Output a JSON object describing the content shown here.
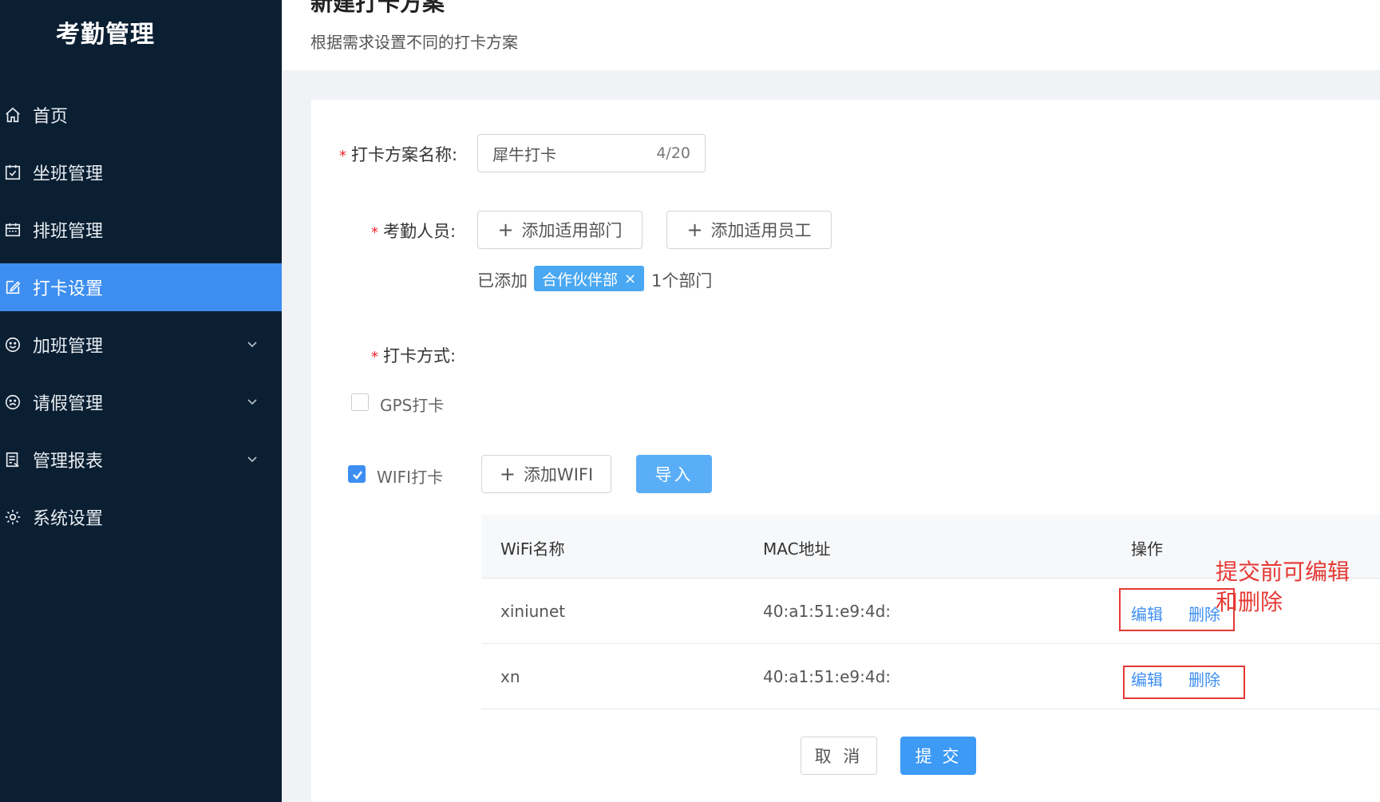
{
  "sidebar": {
    "brand": "考勤管理",
    "items": [
      {
        "label": "首页",
        "icon": "home-icon"
      },
      {
        "label": "坐班管理",
        "icon": "calendar-check-icon"
      },
      {
        "label": "排班管理",
        "icon": "calendar-icon"
      },
      {
        "label": "打卡设置",
        "icon": "edit-icon",
        "active": true
      },
      {
        "label": "加班管理",
        "icon": "smile-icon",
        "has_children": true
      },
      {
        "label": "请假管理",
        "icon": "frown-icon",
        "has_children": true
      },
      {
        "label": "管理报表",
        "icon": "report-icon",
        "has_children": true
      },
      {
        "label": "系统设置",
        "icon": "gear-icon"
      }
    ]
  },
  "header": {
    "title": "新建打卡方案",
    "subtitle": "根据需求设置不同的打卡方案"
  },
  "form": {
    "name_label": "打卡方案名称:",
    "name_value": "犀牛打卡",
    "name_count": "4/20",
    "staff_label": "考勤人员:",
    "add_dept_label": "添加适用部门",
    "add_employee_label": "添加适用员工",
    "added_prefix": "已添加",
    "added_tag": "合作伙伴部",
    "added_suffix": "1个部门",
    "method_label": "打卡方式:",
    "gps_label": "GPS打卡",
    "gps_checked": false,
    "wifi_label": "WIFI打卡",
    "wifi_checked": true,
    "add_wifi_label": "添加WIFI",
    "import_label": "导入"
  },
  "wifi_table": {
    "columns": [
      "WiFi名称",
      "MAC地址",
      "操作"
    ],
    "rows": [
      {
        "name": "xiniunet",
        "mac": "40:a1:51:e9:4d:",
        "edit": "编辑",
        "delete": "删除"
      },
      {
        "name": "xn",
        "mac": "40:a1:51:e9:4d:",
        "edit": "编辑",
        "delete": "删除"
      }
    ]
  },
  "annotation": {
    "text_line1": "提交前可编辑",
    "text_line2": "和删除",
    "color": "#e53935"
  },
  "footer": {
    "cancel_label": "取 消",
    "submit_label": "提 交"
  },
  "colors": {
    "sidebar_bg": "#0b1f33",
    "accent": "#3d8ef0",
    "tag_bg": "#4aa8f2"
  }
}
